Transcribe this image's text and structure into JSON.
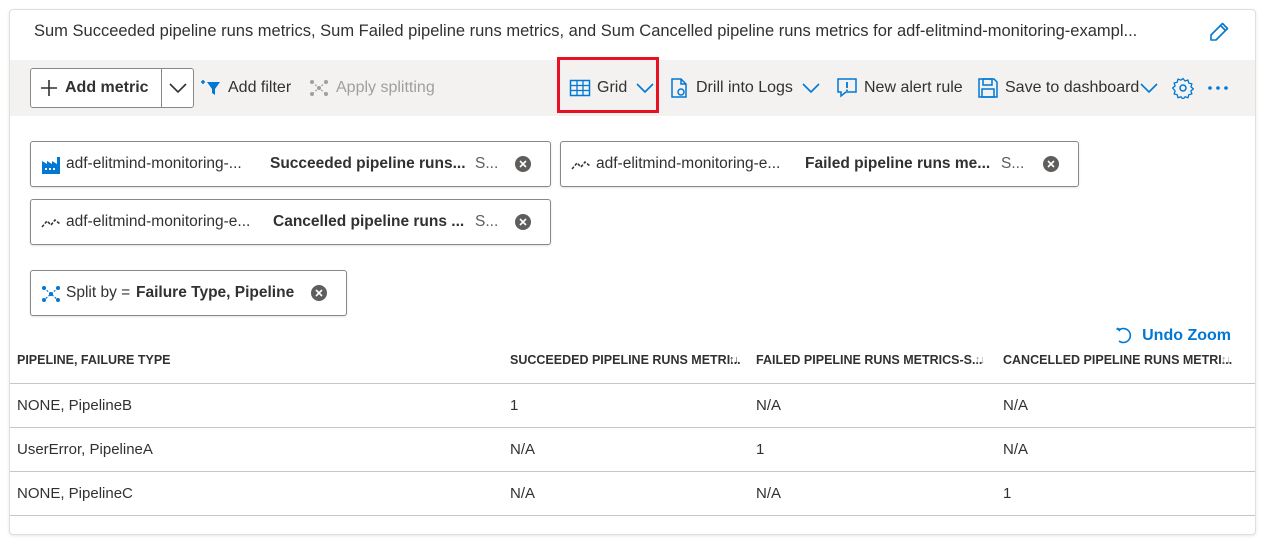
{
  "title": "Sum Succeeded pipeline runs metrics, Sum Failed pipeline runs metrics, and Sum Cancelled pipeline runs metrics for adf-elitmind-monitoring-exampl...",
  "toolbar": {
    "add_metric": "Add metric",
    "add_filter": "Add filter",
    "apply_splitting": "Apply splitting",
    "grid": "Grid",
    "drill_into_logs": "Drill into Logs",
    "new_alert_rule": "New alert rule",
    "save_to_dashboard": "Save to dashboard"
  },
  "metric_pills": [
    {
      "resource": "adf-elitmind-monitoring-...",
      "metric": "Succeeded pipeline runs...",
      "agg": "S...",
      "icon": "data-factory-icon"
    },
    {
      "resource": "adf-elitmind-monitoring-e...",
      "metric": "Failed pipeline runs me...",
      "agg": "S...",
      "icon": "line-chart-icon"
    },
    {
      "resource": "adf-elitmind-monitoring-e...",
      "metric": "Cancelled pipeline runs ...",
      "agg": "S...",
      "icon": "line-chart-icon"
    }
  ],
  "split_pill": {
    "prefix": "Split by = ",
    "value": "Failure Type, Pipeline"
  },
  "undo_zoom": "Undo Zoom",
  "table": {
    "headers": [
      "PIPELINE, FAILURE TYPE",
      "SUCCEEDED PIPELINE RUNS METRI...",
      "FAILED PIPELINE RUNS METRICS-S...",
      "CANCELLED PIPELINE RUNS METRI..."
    ],
    "rows": [
      [
        "NONE, PipelineB",
        "1",
        "N/A",
        "N/A"
      ],
      [
        "UserError, PipelineA",
        "N/A",
        "1",
        "N/A"
      ],
      [
        "NONE, PipelineC",
        "N/A",
        "N/A",
        "1"
      ]
    ]
  },
  "colors": {
    "accent": "#0078d4",
    "highlight": "#e81123",
    "toolbar_bg": "#f3f2f1"
  }
}
